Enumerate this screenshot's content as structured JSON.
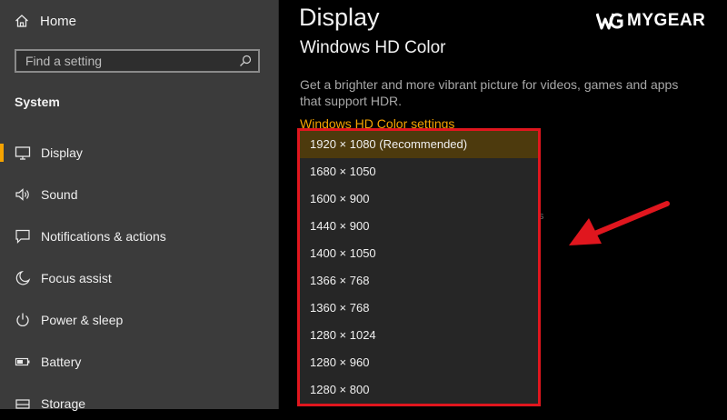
{
  "sidebar": {
    "home_label": "Home",
    "search_placeholder": "Find a setting",
    "section_title": "System",
    "items": [
      {
        "label": "Display",
        "icon": "monitor-icon"
      },
      {
        "label": "Sound",
        "icon": "speaker-icon"
      },
      {
        "label": "Notifications & actions",
        "icon": "chat-icon"
      },
      {
        "label": "Focus assist",
        "icon": "moon-icon"
      },
      {
        "label": "Power & sleep",
        "icon": "power-icon"
      },
      {
        "label": "Battery",
        "icon": "battery-icon"
      },
      {
        "label": "Storage",
        "icon": "storage-icon"
      }
    ]
  },
  "main": {
    "title": "Display",
    "subtitle": "Windows HD Color",
    "description": "Get a brighter and more vibrant picture for videos, games and apps that support HDR.",
    "link": "Windows HD Color settings"
  },
  "brand": {
    "logo_text": "MYGEAR"
  },
  "resolution_dropdown": {
    "selected_index": 0,
    "options": [
      "1920 × 1080 (Recommended)",
      "1680 × 1050",
      "1600 × 900",
      "1440 × 900",
      "1400 × 1050",
      "1366 × 768",
      "1360 × 768",
      "1280 × 1024",
      "1280 × 960",
      "1280 × 800"
    ]
  },
  "colors": {
    "accent": "#f5a300",
    "highlight": "#e0161e",
    "sidebar_bg": "#3b3b3b"
  }
}
